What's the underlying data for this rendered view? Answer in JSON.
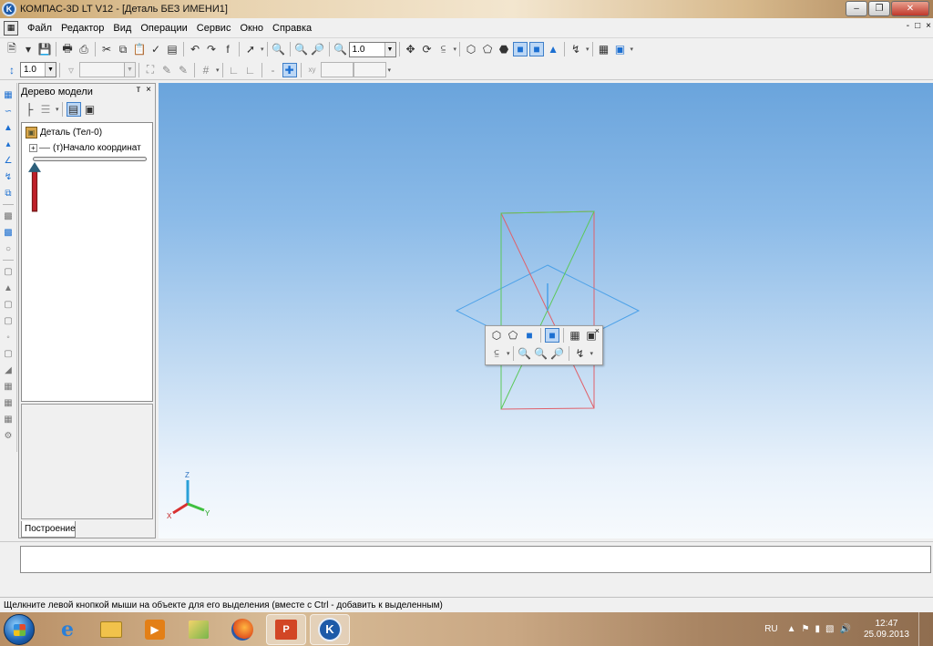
{
  "window": {
    "title": "КОМПАС-3D LT V12 - [Деталь БЕЗ ИМЕНИ1]",
    "app_icon": "kompas-logo",
    "controls": [
      "minimize",
      "restore",
      "close"
    ]
  },
  "menu": {
    "items": [
      "Файл",
      "Редактор",
      "Вид",
      "Операции",
      "Сервис",
      "Окно",
      "Справка"
    ],
    "right_controls": [
      "-",
      "□",
      "×"
    ]
  },
  "toolbar_main": {
    "zoom_value": "1.0"
  },
  "toolbar_current": {
    "step_value": "1.0",
    "disabled_combo_1": "",
    "disabled_combo_2": ""
  },
  "model_tree": {
    "title": "Дерево модели",
    "header_controls": [
      "т",
      "×"
    ],
    "root_label": "Деталь (Тел-0)",
    "child_label": "(т)Начало координат",
    "tab_label": "Построение"
  },
  "floating_toolbar": {
    "close": "×"
  },
  "axes": {
    "z": "Z",
    "x": "X",
    "y": "Y"
  },
  "status": {
    "hint": "Щелкните левой кнопкой мыши на объекте для его выделения (вместе с Ctrl - добавить к выделенным)"
  },
  "taskbar": {
    "language": "RU",
    "time": "12:47",
    "date": "25.09.2013"
  },
  "colors": {
    "plane_xy": "#4aa0e8",
    "plane_zx": "#e0606a",
    "plane_zy": "#5cc85a",
    "viewport_top": "#6aa4dc",
    "viewport_bottom": "#f7fafd",
    "annotation_arrow": "#c0202a"
  }
}
